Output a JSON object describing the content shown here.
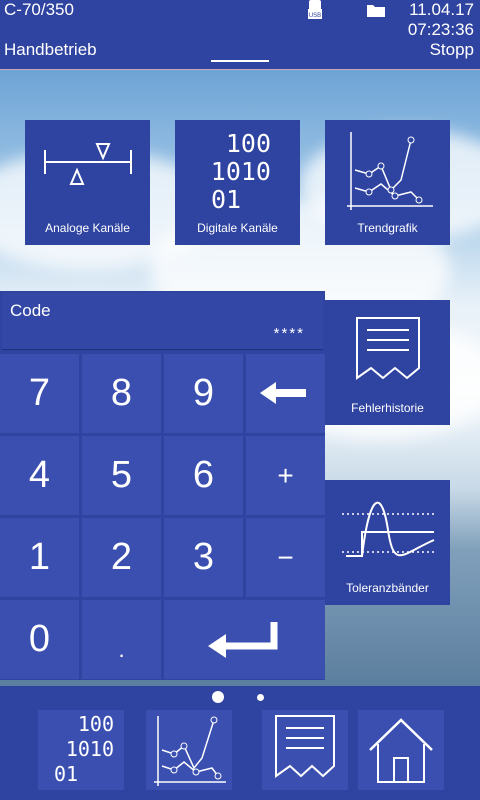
{
  "header": {
    "machine": "C-70/350",
    "mode": "Handbetrieb",
    "date": "11.04.17",
    "time": "07:23:36",
    "state": "Stopp",
    "usb_label": "USB"
  },
  "tiles": {
    "analog": "Analoge Kanäle",
    "digital": "Digitale Kanäle",
    "digital_bits": [
      "100",
      "1010",
      "01"
    ],
    "trend": "Trendgrafik",
    "errors": "Fehlerhistorie",
    "tolerance": "Toleranzbänder"
  },
  "keypad": {
    "code_label": "Code",
    "code_value": "****",
    "keys": [
      "7",
      "8",
      "9",
      "4",
      "5",
      "6",
      "+",
      "1",
      "2",
      "3",
      "−",
      "0",
      "."
    ]
  },
  "bottom": {
    "digital_bits": [
      "100",
      "1010",
      "01"
    ]
  }
}
